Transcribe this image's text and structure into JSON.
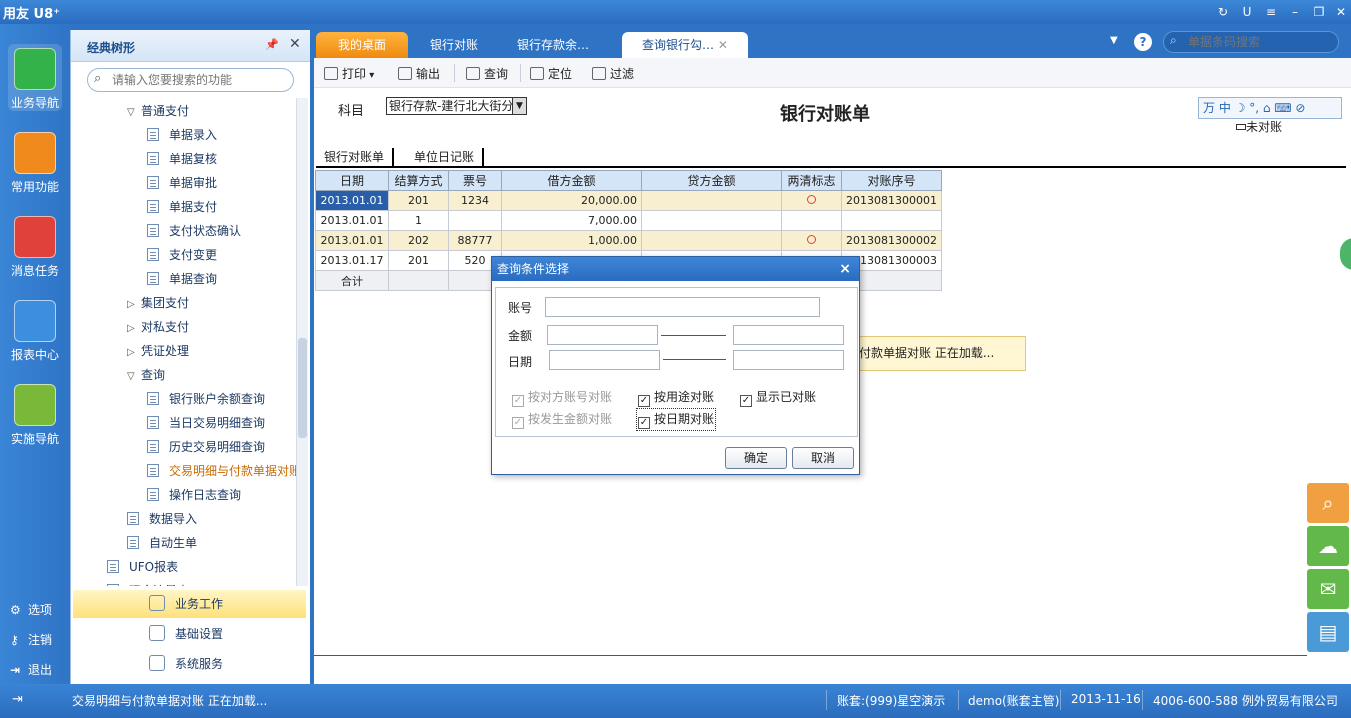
{
  "app": {
    "title": "用友 U8⁺"
  },
  "leftnav": [
    {
      "label": "业务导航",
      "icon": "business-nav-icon",
      "color": "#34b24a"
    },
    {
      "label": "常用功能",
      "icon": "star-icon",
      "color": "#f08a1c"
    },
    {
      "label": "消息任务",
      "icon": "envelope-icon",
      "color": "#e0413a"
    },
    {
      "label": "报表中心",
      "icon": "report-icon",
      "color": "#3e8ee0"
    },
    {
      "label": "实施导航",
      "icon": "compass-icon",
      "color": "#7ab83a"
    }
  ],
  "bottomnav": [
    {
      "label": "选项",
      "icon": "gear-icon",
      "sym": "⚙"
    },
    {
      "label": "注销",
      "icon": "key-icon",
      "sym": "⚷"
    },
    {
      "label": "退出",
      "icon": "exit-icon",
      "sym": "⇥"
    }
  ],
  "tree": {
    "title": "经典树形",
    "search_placeholder": "请输入您要搜索的功能",
    "items": [
      {
        "label": "普通支付",
        "type": "folder-open",
        "level": 1
      },
      {
        "label": "单据录入",
        "type": "doc",
        "level": 2
      },
      {
        "label": "单据复核",
        "type": "doc",
        "level": 2
      },
      {
        "label": "单据审批",
        "type": "doc",
        "level": 2
      },
      {
        "label": "单据支付",
        "type": "doc",
        "level": 2
      },
      {
        "label": "支付状态确认",
        "type": "doc",
        "level": 2
      },
      {
        "label": "支付变更",
        "type": "doc",
        "level": 2
      },
      {
        "label": "单据查询",
        "type": "doc",
        "level": 2
      },
      {
        "label": "集团支付",
        "type": "folder",
        "level": 1
      },
      {
        "label": "对私支付",
        "type": "folder",
        "level": 1
      },
      {
        "label": "凭证处理",
        "type": "folder",
        "level": 1
      },
      {
        "label": "查询",
        "type": "folder-open",
        "level": 1
      },
      {
        "label": "银行账户余额查询",
        "type": "doc",
        "level": 2
      },
      {
        "label": "当日交易明细查询",
        "type": "doc",
        "level": 2
      },
      {
        "label": "历史交易明细查询",
        "type": "doc",
        "level": 2
      },
      {
        "label": "交易明细与付款单据对账",
        "type": "doc",
        "level": 2,
        "highlight": true
      },
      {
        "label": "操作日志查询",
        "type": "doc",
        "level": 2
      },
      {
        "label": "数据导入",
        "type": "doc",
        "level": 1
      },
      {
        "label": "自动生单",
        "type": "doc",
        "level": 1
      },
      {
        "label": "UFO报表",
        "type": "doc",
        "level": 0
      },
      {
        "label": "现金流量表",
        "type": "doc",
        "level": 0
      }
    ],
    "panels": [
      {
        "label": "业务工作",
        "active": true
      },
      {
        "label": "基础设置",
        "active": false
      },
      {
        "label": "系统服务",
        "active": false
      }
    ]
  },
  "tabs": [
    {
      "label": "我的桌面",
      "kind": "home"
    },
    {
      "label": "银行对账",
      "kind": "normal"
    },
    {
      "label": "银行存款余…",
      "kind": "normal"
    },
    {
      "label": "查询银行勾…",
      "kind": "current"
    }
  ],
  "bill_search_placeholder": "单据条码搜索",
  "toolbar": [
    {
      "label": "打印",
      "icon": "print-icon"
    },
    {
      "label": "输出",
      "icon": "export-icon"
    },
    {
      "label": "查询",
      "icon": "query-icon"
    },
    {
      "label": "定位",
      "icon": "locate-icon"
    },
    {
      "label": "过滤",
      "icon": "filter-icon"
    }
  ],
  "form": {
    "subject_label": "科目",
    "subject_value": "银行存款-建行北大街分",
    "report_title": "银行对账单",
    "ime_text": "万 中 ☽ °, ⌂ ⌨ ⊘",
    "unreconciled_label": "未对账"
  },
  "subtabs": [
    "银行对账单",
    "单位日记账"
  ],
  "grid": {
    "headers": [
      "日期",
      "结算方式",
      "票号",
      "借方金额",
      "贷方金额",
      "两清标志",
      "对账序号"
    ],
    "rows": [
      {
        "date": "2013.01.01",
        "method": "201",
        "ticket": "1234",
        "debit": "20,000.00",
        "credit": "",
        "cleared": true,
        "seq": "2013081300001"
      },
      {
        "date": "2013.01.01",
        "method": "1",
        "ticket": "",
        "debit": "7,000.00",
        "credit": "",
        "cleared": false,
        "seq": ""
      },
      {
        "date": "2013.01.01",
        "method": "202",
        "ticket": "88777",
        "debit": "1,000.00",
        "credit": "",
        "cleared": true,
        "seq": "2013081300002"
      },
      {
        "date": "2013.01.17",
        "method": "201",
        "ticket": "520",
        "debit": "",
        "credit": "",
        "cleared": false,
        "seq": "2013081300003"
      }
    ],
    "total_label": "合计"
  },
  "loading_text": "付款单据对账 正在加载...",
  "dialog": {
    "title": "查询条件选择",
    "account_label": "账号",
    "amount_label": "金额",
    "date_label": "日期",
    "checks": [
      {
        "label": "按对方账号对账",
        "checked": true,
        "disabled": true
      },
      {
        "label": "按用途对账",
        "checked": true,
        "disabled": false
      },
      {
        "label": "显示已对账",
        "checked": true,
        "disabled": false
      },
      {
        "label": "按发生金额对账",
        "checked": true,
        "disabled": true
      },
      {
        "label": "按日期对账",
        "checked": true,
        "disabled": false
      }
    ],
    "ok": "确定",
    "cancel": "取消"
  },
  "status": {
    "message": "交易明细与付款单据对账 正在加载...",
    "account_set": "账套:(999)星空演示",
    "user": "demo(账套主管)",
    "date": "2013-11-16",
    "company": "4006-600-588 例外贸易有限公司"
  },
  "right_float": [
    {
      "icon": "search-icon",
      "color": "#f0a040"
    },
    {
      "icon": "cloud-icon",
      "color": "#62b94a"
    },
    {
      "icon": "chat-icon",
      "color": "#62b94a"
    },
    {
      "icon": "inbox-icon",
      "color": "#4a9ad8"
    }
  ]
}
